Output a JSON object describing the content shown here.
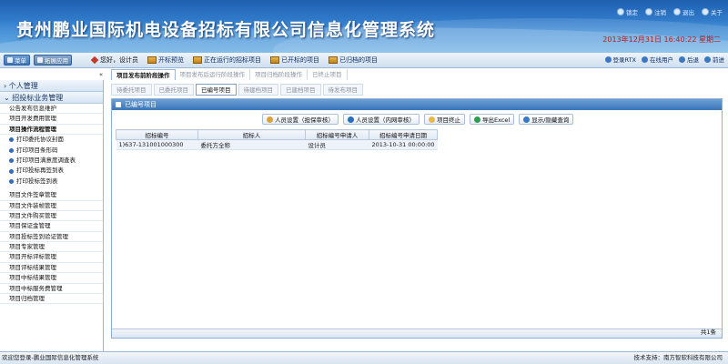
{
  "header": {
    "title": "贵州鹏业国际机电设备招标有限公司信息化管理系统",
    "links": [
      {
        "label": "锁定",
        "icon": "lock-icon"
      },
      {
        "label": "注销",
        "icon": "logout-icon"
      },
      {
        "label": "退出",
        "icon": "exit-icon"
      },
      {
        "label": "关于",
        "icon": "about-icon"
      }
    ],
    "datetime": "2013年12月31日  16:40:22  星期二"
  },
  "toolbar": {
    "buttons": [
      "菜单",
      "拓展应用"
    ],
    "greeting": "您好，设计员",
    "quick": [
      "开标预览",
      "正在运行的招标项目",
      "已开标的项目",
      "已归档的项目"
    ],
    "right": [
      "登录RTX",
      "在线用户",
      "后退",
      "前进"
    ]
  },
  "sidebar": {
    "groups": [
      "个人管理",
      "招投标业务管理"
    ],
    "items_top": [
      "公告发布信息维护",
      "项目开发费用管理",
      "项目操作流程管理"
    ],
    "subs": [
      "打印委托协议封面",
      "打印项目条形码",
      "打印项目满意度调查表",
      "打印投标再签到表",
      "打印投标签到表"
    ],
    "items_bottom": [
      "项目文件签章管理",
      "项目文件装帧管理",
      "项目文件购买管理",
      "项目保证金管理",
      "项目投标签到验证管理",
      "项目专家管理",
      "项目开标评标管理",
      "项目评标结果管理",
      "项目中标结果管理",
      "项目中标服务费管理",
      "项目归档管理"
    ]
  },
  "main_tabs": [
    "项目发布前阶段操作",
    "项目发布后运行阶段操作",
    "项目归档阶段操作",
    "已终止项目"
  ],
  "sub_tabs": [
    "待委托项目",
    "已委托项目",
    "已编号项目",
    "待建档项目",
    "已建档项目",
    "待发布项目"
  ],
  "panel": {
    "title": "已编号项目",
    "actions": [
      {
        "label": "人员设置（担保审核）",
        "icon": "user-icon",
        "color": "#d9a33a"
      },
      {
        "label": "人员设置（内网审核）",
        "icon": "eye-icon",
        "color": "#2d6cc1"
      },
      {
        "label": "项目终止",
        "icon": "stop-icon",
        "color": "#e8b84a"
      },
      {
        "label": "导出Excel",
        "icon": "excel-icon",
        "color": "#2f9d4f"
      },
      {
        "label": "显示/隐藏查询",
        "icon": "search-icon",
        "color": "#3b78c3"
      }
    ],
    "columns": [
      "招标编号",
      "招标人",
      "招标编号申请人",
      "招标编号申请日期"
    ],
    "rows": [
      [
        "1)637-131001000300",
        "委托方全称",
        "设计员",
        "2013-10-31 00:00:00"
      ]
    ],
    "count": "共1条"
  },
  "status": {
    "left": "欢迎您登录-鹏业国际信息化管理系统",
    "right": "技术支持：南方智软科技有限公司"
  }
}
